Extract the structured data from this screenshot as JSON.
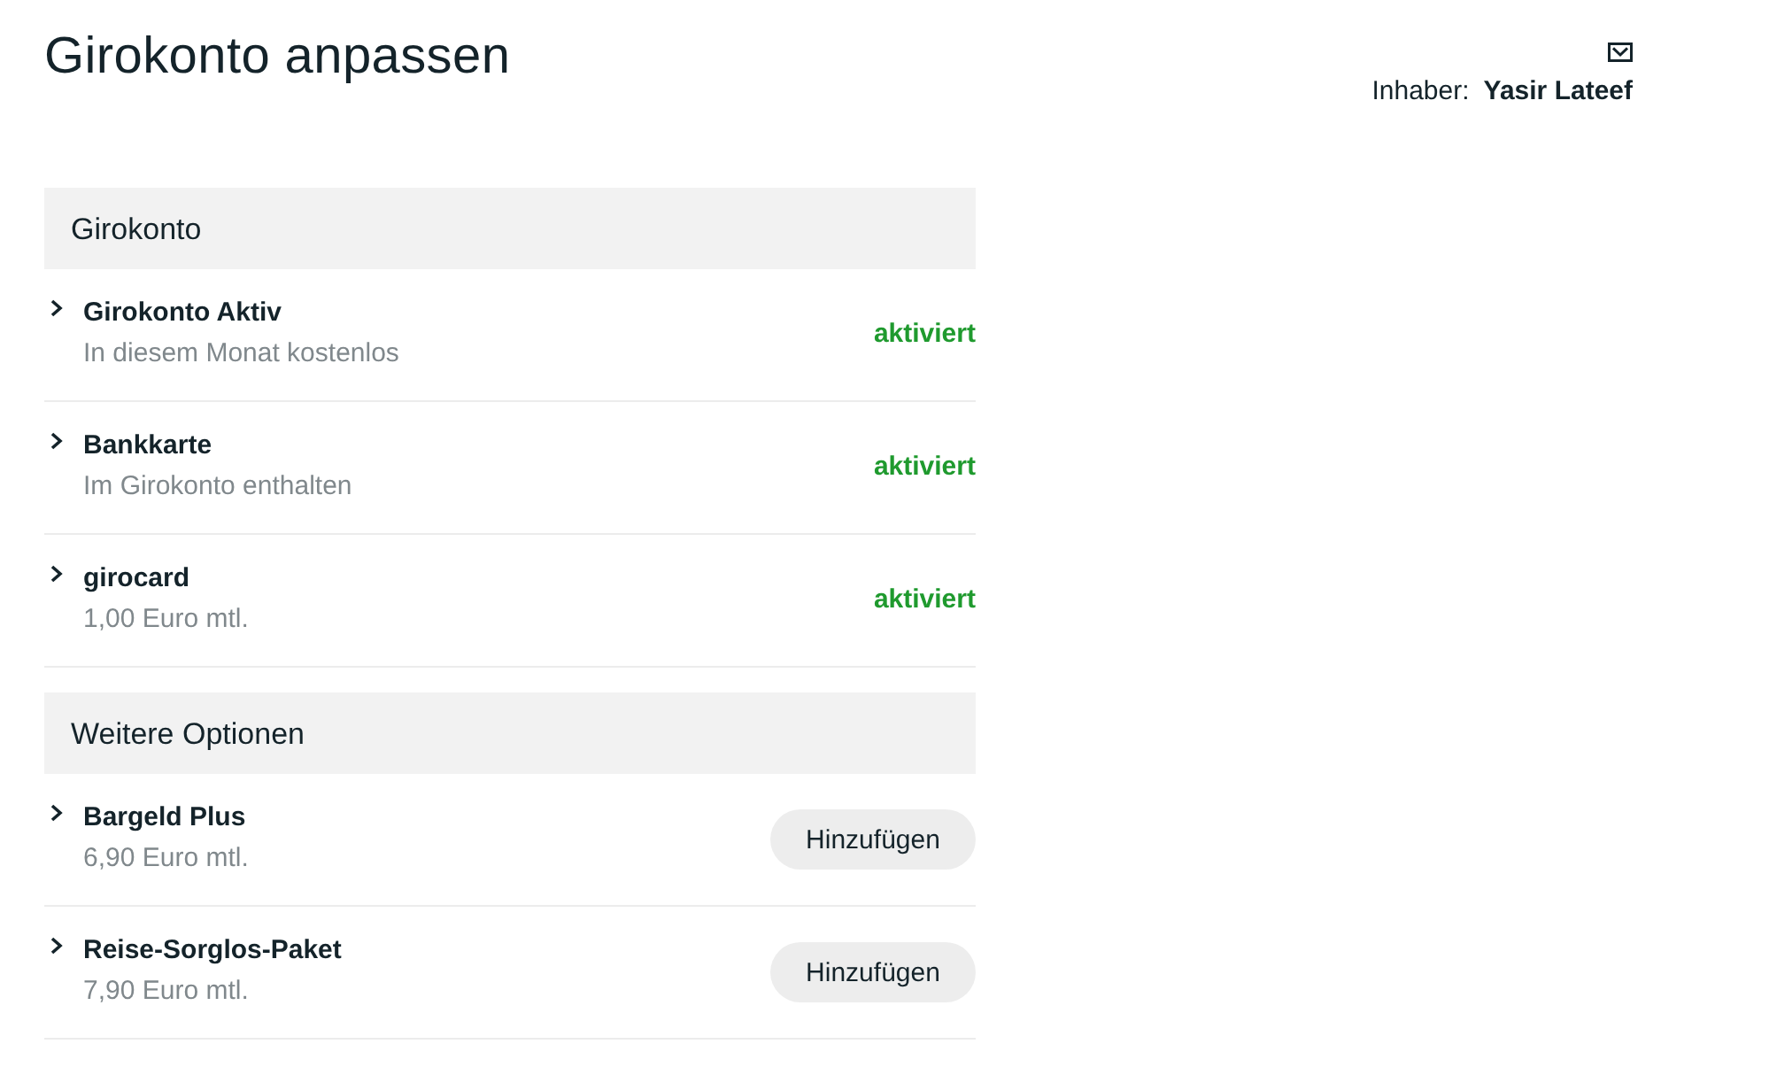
{
  "page": {
    "title": "Girokonto anpassen"
  },
  "owner": {
    "label": "Inhaber:",
    "name": "Yasir Lateef"
  },
  "sections": [
    {
      "title": "Girokonto",
      "items": [
        {
          "name": "Girokonto Aktiv",
          "detail": "In diesem Monat kostenlos",
          "expanded": false,
          "kind": "status",
          "status": "aktiviert"
        },
        {
          "name": "Bankkarte",
          "detail": "Im Girokonto enthalten",
          "expanded": false,
          "kind": "status",
          "status": "aktiviert"
        },
        {
          "name": "girocard",
          "detail": "1,00 Euro mtl.",
          "expanded": false,
          "kind": "status",
          "status": "aktiviert"
        }
      ]
    },
    {
      "title": "Weitere Optionen",
      "items": [
        {
          "name": "Bargeld Plus",
          "detail": "6,90 Euro mtl.",
          "expanded": false,
          "kind": "action",
          "action": "Hinzufügen"
        },
        {
          "name": "Reise-Sorglos-Paket",
          "detail": "7,90 Euro mtl.",
          "expanded": false,
          "kind": "action",
          "action": "Hinzufügen"
        }
      ]
    }
  ]
}
